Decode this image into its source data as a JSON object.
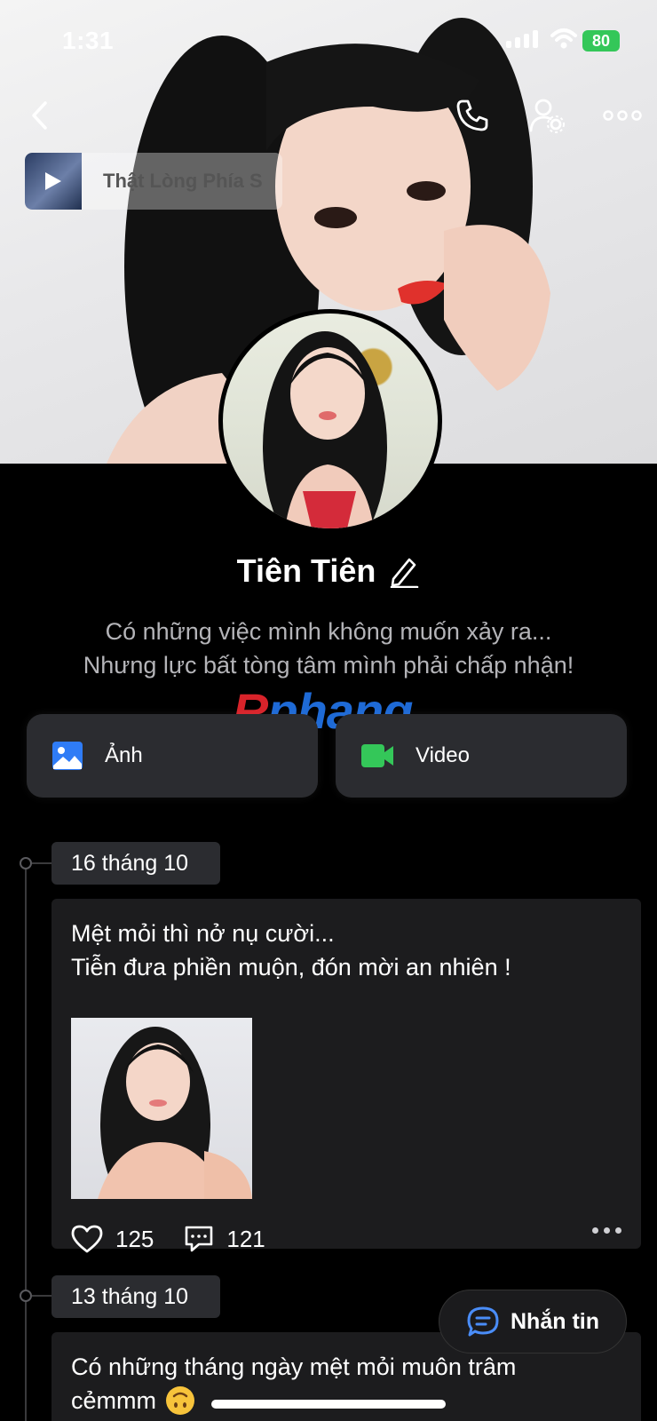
{
  "status_bar": {
    "time": "1:31",
    "battery": "80"
  },
  "music": {
    "title": "Thật Lòng Phía S"
  },
  "profile": {
    "name": "Tiên Tiên",
    "bio_line1": "Có những việc mình không muốn xảy ra...",
    "bio_line2": "Nhưng lực bất tòng tâm mình phải chấp nhận!"
  },
  "watermark": {
    "first": "R",
    "rest": "phang"
  },
  "media": {
    "photos_label": "Ảnh",
    "video_label": "Video"
  },
  "timeline": [
    {
      "date": "16 tháng 10",
      "text_line1": "Mệt mỏi thì nở nụ cười...",
      "text_line2": "Tiễn đưa phiền muộn, đón mời an nhiên !",
      "likes": "125",
      "comments": "121"
    },
    {
      "date": "13 tháng 10",
      "text_line1": "Có những tháng ngày mệt mỏi muôn trâm",
      "text_line2": "cẻmmm"
    }
  ],
  "message_button": {
    "label": "Nhắn tin"
  },
  "colors": {
    "accent_blue": "#1e6ad6",
    "video_green": "#34c759",
    "battery_green": "#34c759"
  }
}
